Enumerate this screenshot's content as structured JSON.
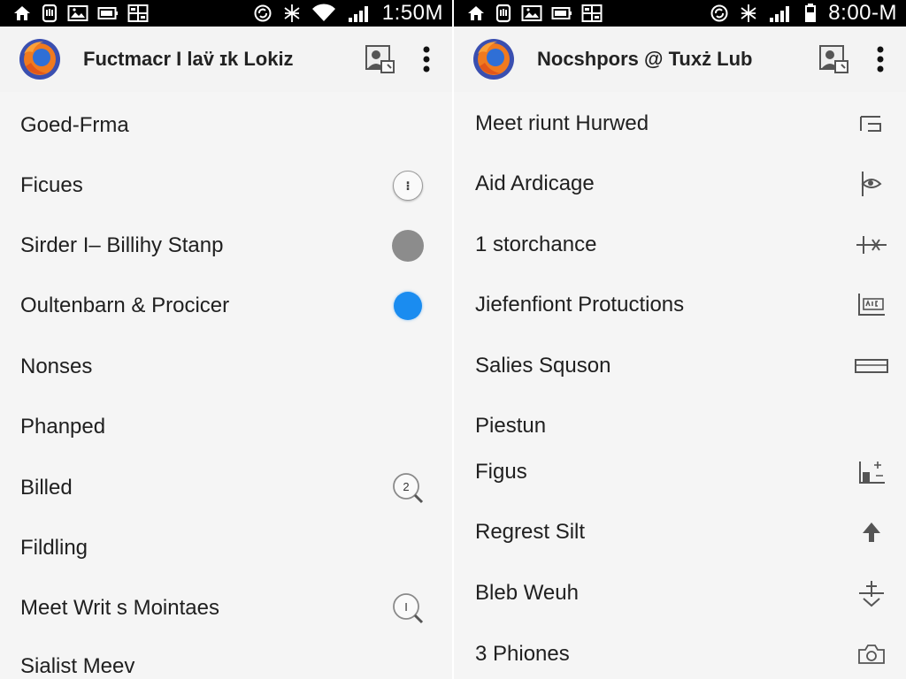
{
  "screens": [
    {
      "status": {
        "time": "1:50M",
        "left_icons": [
          "home-icon",
          "hand-icon",
          "image-notification-icon",
          "battery-outline-icon",
          "grid-notification-icon"
        ],
        "right_icons": [
          "sync-icon",
          "bluetooth-icon",
          "wifi-icon",
          "signal-icon"
        ]
      },
      "app_bar": {
        "logo": "firefox-logo-icon",
        "title": "Fuctmacr I lav̈ ɪk Lokiz",
        "actions": [
          "contact-card-icon",
          "overflow-menu-icon"
        ]
      },
      "items": [
        {
          "label": "Goed-Frma",
          "trail": "none"
        },
        {
          "label": "Ficues",
          "trail": "info-circle-icon",
          "trail_text": "⁝"
        },
        {
          "label": "Sirder I– Billihy Stanp",
          "trail": "gray-circle-icon"
        },
        {
          "label": "Oultenbarn & Procicer",
          "trail": "blue-dot-icon"
        },
        {
          "label": "Nonses",
          "trail": "none"
        },
        {
          "label": "Phanped",
          "trail": "none"
        },
        {
          "label": "Billed",
          "trail": "search-badge-icon",
          "trail_text": "2"
        },
        {
          "label": "Fildling",
          "trail": "none"
        },
        {
          "label": "Meet Writ s Mointaes",
          "trail": "search-badge-icon",
          "trail_text": "I"
        },
        {
          "label": "Sialist Meev",
          "trail": "none"
        }
      ]
    },
    {
      "status": {
        "time": "8:00-M",
        "left_icons": [
          "home-icon",
          "hand-icon",
          "image-notification-icon",
          "battery-outline-icon",
          "grid-notification-icon"
        ],
        "right_icons": [
          "sync-icon",
          "bluetooth-icon",
          "signal-icon",
          "battery-icon"
        ]
      },
      "app_bar": {
        "logo": "firefox-logo-icon",
        "title": "Nocshpors @ Tuxż Lub",
        "actions": [
          "contact-card-icon",
          "overflow-menu-icon"
        ]
      },
      "items": [
        {
          "label": "Meet riunt Hurwed",
          "trail": "bracket-glyph-icon"
        },
        {
          "label": "Aid Ardicage",
          "trail": "eye-flag-icon"
        },
        {
          "label": "1 storchance",
          "trail": "cross-link-icon"
        },
        {
          "label": "Jiefenfiont Protuctions",
          "trail": "abc-glyph-icon"
        },
        {
          "label": "Salies Squson",
          "trail": "ruler-icon"
        },
        {
          "label": "Piestun",
          "trail": "none"
        },
        {
          "label": "Figus",
          "trail": "chart-glyph-icon"
        },
        {
          "label": "Regrest Silt",
          "trail": "arrow-up-icon"
        },
        {
          "label": "Bleb Weuh",
          "trail": "balance-icon"
        },
        {
          "label": "3 Phiones",
          "trail": "camera-outline-icon"
        }
      ]
    }
  ]
}
